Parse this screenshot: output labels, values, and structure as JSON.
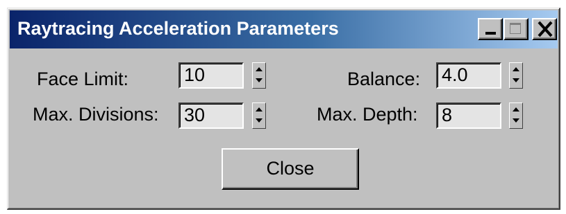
{
  "window": {
    "title": "Raytracing Acceleration Parameters"
  },
  "title_buttons": {
    "minimize_icon": "minimize-icon",
    "maximize_icon": "maximize-icon",
    "close_icon": "close-icon"
  },
  "fields": {
    "face_limit": {
      "label": "Face Limit:",
      "value": "10"
    },
    "max_divisions": {
      "label": "Max. Divisions:",
      "value": "30"
    },
    "balance": {
      "label": "Balance:",
      "value": "4.0"
    },
    "max_depth": {
      "label": "Max. Depth:",
      "value": "8"
    }
  },
  "buttons": {
    "close_label": "Close"
  },
  "colors": {
    "title_gradient_start": "#0a246a",
    "title_gradient_end": "#a6caf0",
    "face": "#c0c0c0",
    "field_bg": "#e4e4e4"
  }
}
